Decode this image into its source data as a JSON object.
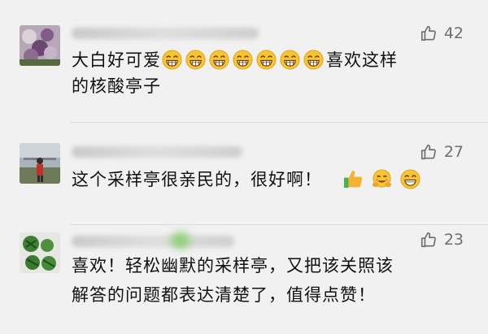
{
  "comments": [
    {
      "likes": "42",
      "text_before": "大白好可爱",
      "text_after": "喜欢这样",
      "line2": "的核酸亭子",
      "emoji_icons": [
        "grinning-face-icon",
        "grinning-face-icon",
        "grinning-face-icon",
        "grinning-face-icon",
        "grinning-face-icon",
        "grinning-face-icon",
        "grinning-face-icon"
      ]
    },
    {
      "likes": "27",
      "text": "这个采样亭很亲民的，很好啊！",
      "emoji_icons": [
        "thumbs-up-icon",
        "hugging-face-icon",
        "grinning-face-icon"
      ]
    },
    {
      "likes": "23",
      "line1": "喜欢！轻松幽默的采样亭，又把该关照该",
      "line2": "解答的问题都表达清楚了，值得点赞！"
    }
  ],
  "colors": {
    "background": "#f1f1f1",
    "text": "#111111",
    "like": "#6e6e6e",
    "emoji_face": "#f7c531"
  }
}
